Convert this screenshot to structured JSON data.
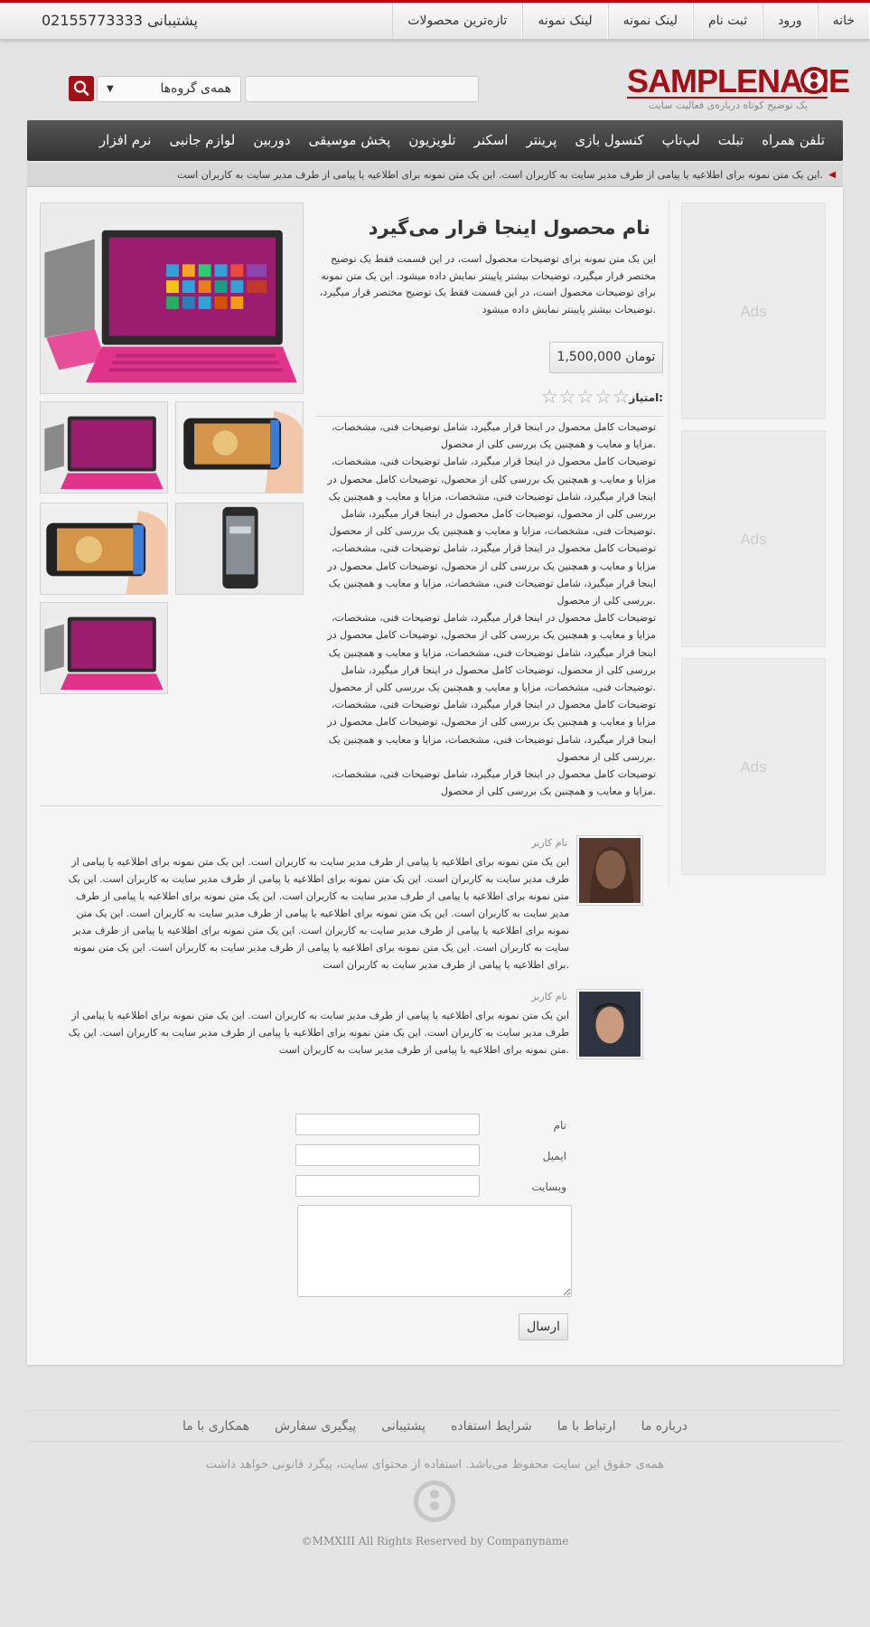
{
  "topbar": {
    "links": [
      "خانه",
      "ورود",
      "ثبت نام",
      "لینک نمونه",
      "لینک نمونه",
      "تازه‌ترین محصولات"
    ],
    "support": "پشتیبانی 02155773333"
  },
  "brand": {
    "name": "SAMPLENAME",
    "tagline": "یک توضیح کوتاه درباره‌ی فعالیت سایت",
    "color": "#a01016"
  },
  "search": {
    "placeholder": "",
    "group_selected": "همه‌ی گروه‌ها"
  },
  "nav": [
    "تلفن همراه",
    "تبلت",
    "لپ‌تاپ",
    "کنسول بازی",
    "پرینتر",
    "اسکنر",
    "تلویزیون",
    "پخش موسیقی",
    "دوربین",
    "لوازم جانبی",
    "نرم افزار"
  ],
  "ticker": "این یک متن نمونه برای اطلاعیه یا پیامی از طرف مدیر سایت به کاربران است. این یک متن نمونه برای اطلاعیه یا پیامی از طرف مدیر سایت به کاربران است.",
  "ads": [
    "Ads",
    "Ads",
    "Ads"
  ],
  "product": {
    "title": "نام محصول اینجا قرار می‌گیرد",
    "short_desc": "این یک متن نمونه برای توضیحات محصول است، در این قسمت فقط یک توضیح مختصر قرار میگیرد، توضیحات بیشتر پایینتر نمایش داده میشود. این یک متن نمونه برای توضیحات محصول است، در این قسمت فقط یک توضیح مختصر قرار میگیرد، توضیحات بیشتر پایینتر نمایش داده میشود.",
    "price": "1,500,000 تومان",
    "rating_label": "امتیاز:",
    "rating_stars": "☆☆☆☆☆",
    "rating_value": 0,
    "full_desc": [
      "توضیحات کامل محصول در اینجا قرار میگیرد، شامل توضیحات فنی، مشخصات، مزایا و معایب و همچنین یک بررسی کلی از محصول.",
      "توضیحات کامل محصول در اینجا قرار میگیرد، شامل توضیحات فنی، مشخصات، مزایا و معایب و همچنین یک بررسی کلی از محصول، توضیحات کامل محصول در اینجا قرار میگیرد، شامل توضیحات فنی، مشخصات، مزایا و معایب و همچنین یک بررسی کلی از محصول، توضیحات کامل محصول در اینجا قرار میگیرد، شامل توضیحات فنی، مشخصات، مزایا و معایب و همچنین یک بررسی کلی از محصول.",
      "توضیحات کامل محصول در اینجا قرار میگیرد، شامل توضیحات فنی، مشخصات، مزایا و معایب و همچنین یک بررسی کلی از محصول، توضیحات کامل محصول در اینجا قرار میگیرد، شامل توضیحات فنی، مشخصات، مزایا و معایب و همچنین یک بررسی کلی از محصول.",
      "توضیحات کامل محصول در اینجا قرار میگیرد، شامل توضیحات فنی، مشخصات، مزایا و معایب و همچنین یک بررسی کلی از محصول، توضیحات کامل محصول در اینجا قرار میگیرد، شامل توضیحات فنی، مشخصات، مزایا و معایب و همچنین یک بررسی کلی از محصول، توضیحات کامل محصول در اینجا قرار میگیرد، شامل توضیحات فنی، مشخصات، مزایا و معایب و همچنین یک بررسی کلی از محصول.",
      "توضیحات کامل محصول در اینجا قرار میگیرد، شامل توضیحات فنی، مشخصات، مزایا و معایب و همچنین یک بررسی کلی از محصول، توضیحات کامل محصول در اینجا قرار میگیرد، شامل توضیحات فنی، مشخصات، مزایا و معایب و همچنین یک بررسی کلی از محصول.",
      "توضیحات کامل محصول در اینجا قرار میگیرد، شامل توضیحات فنی، مشخصات، مزایا و معایب و همچنین یک بررسی کلی از محصول."
    ],
    "images": [
      "tablet-pink",
      "tablet-pink",
      "phone-hand",
      "phone-hand",
      "phone-htc",
      "tablet-pink"
    ]
  },
  "comments": [
    {
      "name": "نام کاربر",
      "text": "این یک متن نمونه برای اطلاعیه یا پیامی از طرف مدیر سایت به کاربران است. این یک متن نمونه برای اطلاعیه یا پیامی از طرف مدیر سایت به کاربران است. این یک متن نمونه برای اطلاعیه یا پیامی از طرف مدیر سایت به کاربران است. این یک متن نمونه برای اطلاعیه یا پیامی از طرف مدیر سایت به کاربران است. این یک متن نمونه برای اطلاعیه یا پیامی از طرف مدیر سایت به کاربران است. این یک متن نمونه برای اطلاعیه یا پیامی از طرف مدیر سایت به کاربران است. این یک متن نمونه برای اطلاعیه یا پیامی از طرف مدیر سایت به کاربران است. این یک متن نمونه برای اطلاعیه یا پیامی از طرف مدیر سایت به کاربران است. این یک متن نمونه برای اطلاعیه یا پیامی از طرف مدیر سایت به کاربران است. این یک متن نمونه برای اطلاعیه یا پیامی از طرف مدیر سایت به کاربران است."
    },
    {
      "name": "نام کاربر",
      "text": "این یک متن نمونه برای اطلاعیه یا پیامی از طرف مدیر سایت به کاربران است. این یک متن نمونه برای اطلاعیه یا پیامی از طرف مدیر سایت به کاربران است. این یک متن نمونه برای اطلاعیه یا پیامی از طرف مدیر سایت به کاربران است. این یک متن نمونه برای اطلاعیه یا پیامی از طرف مدیر سایت به کاربران است."
    }
  ],
  "form": {
    "name_label": "نام",
    "email_label": "ایمیل",
    "website_label": "وبسایت",
    "name_value": "",
    "email_value": "",
    "website_value": "",
    "message_value": "",
    "submit_label": "ارسال"
  },
  "footer": {
    "links": [
      "درباره ما",
      "ارتباط با ما",
      "شرایط استفاده",
      "پشتیبانی",
      "پیگیری سفارش",
      "همکاری با ما"
    ],
    "copyright_fa": "همه‌ی حقوق این سایت محفوظ می‌باشد. استفاده از محتوای سایت، پیگرد قانونی خواهد داشت",
    "copyright_en": "©MMXIII All Rights Reserved by Companyname"
  }
}
